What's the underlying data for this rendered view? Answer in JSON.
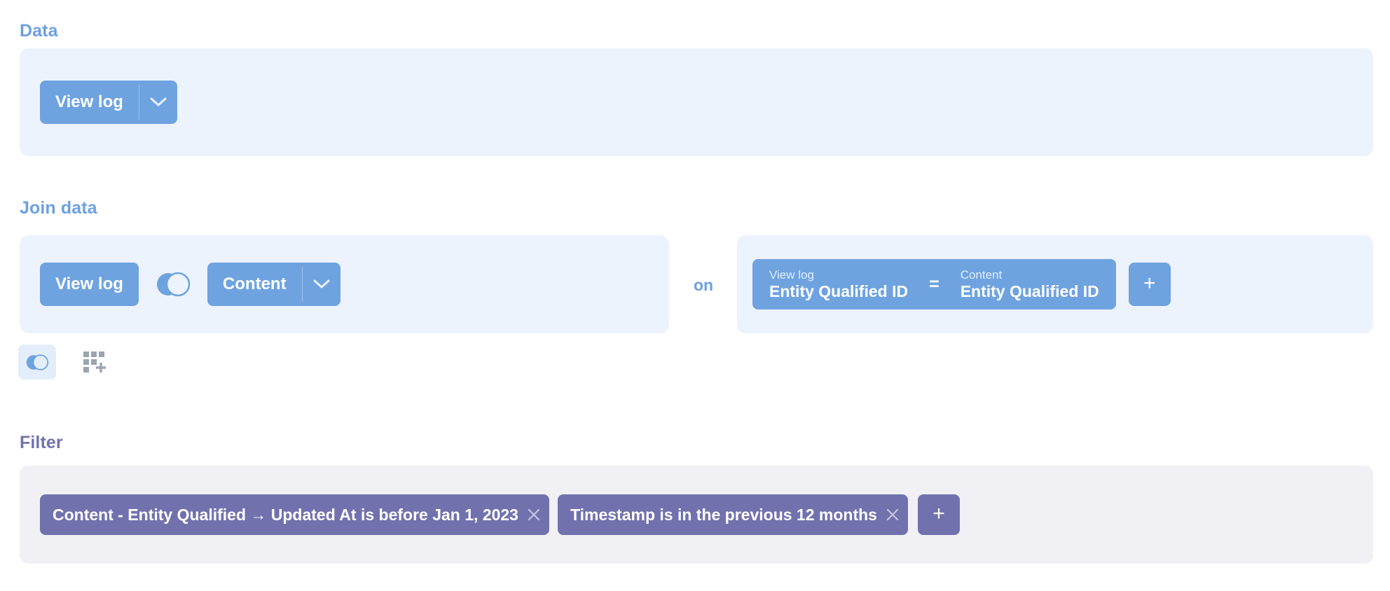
{
  "sections": {
    "data": {
      "label": "Data",
      "source_button": {
        "label": "View log",
        "caret_icon": "chevron-down-icon"
      }
    },
    "join": {
      "label": "Join data",
      "left_table": {
        "label": "View log"
      },
      "join_type_icon": "venn-left-join-icon",
      "right_table": {
        "label": "Content",
        "caret_icon": "chevron-down-icon"
      },
      "on_word": "on",
      "condition": {
        "left_table": "View log",
        "left_field": "Entity Qualified ID",
        "operator": "=",
        "right_table": "Content",
        "right_field": "Entity Qualified ID"
      },
      "add_condition_button": {
        "label": "+",
        "icon": "plus-icon"
      },
      "toolbar": [
        {
          "name": "join-step-icon",
          "label": "venn-left-join-icon",
          "active": true
        },
        {
          "name": "custom-column-icon",
          "label": "grid-plus-icon",
          "active": false
        }
      ]
    },
    "filter": {
      "label": "Filter",
      "pills": [
        {
          "text": "Content - Entity Qualified → Updated At is before Jan 1, 2023",
          "remove_icon": "close-icon"
        },
        {
          "text": "Timestamp is in the previous 12 months",
          "remove_icon": "close-icon"
        }
      ],
      "add_filter_button": {
        "label": "+",
        "icon": "plus-icon"
      }
    }
  },
  "colors": {
    "accent_blue": "#6ea3e0",
    "panel_blue": "#edf3fc",
    "accent_purple": "#7172ad",
    "panel_grey": "#f0f0f5",
    "label_blue": "#6da0e0",
    "icon_grey": "#9aa4b2"
  }
}
